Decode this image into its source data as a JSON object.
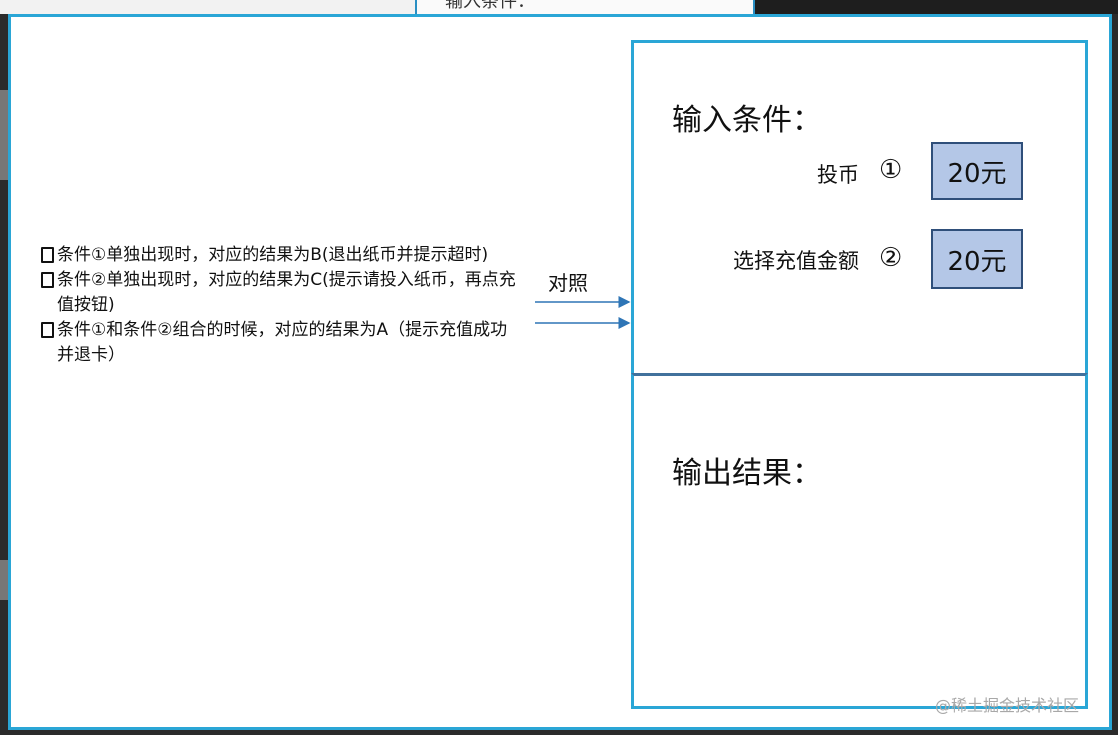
{
  "top_fragment": "输入条件：",
  "conditions": [
    "条件①单独出现时，对应的结果为B(退出纸币并提示超时)",
    "条件②单独出现时，对应的结果为C(提示请投入纸币，再点充值按钮)",
    "条件①和条件②组合的时候，对应的结果为A（提示充值成功并退卡）"
  ],
  "compare_label": "对照",
  "input_box": {
    "heading": "输入条件：",
    "rows": [
      {
        "label": "投币",
        "marker": "①",
        "value": "20元"
      },
      {
        "label": "选择充值金额",
        "marker": "②",
        "value": "20元"
      }
    ]
  },
  "output_box": {
    "heading": "输出结果："
  },
  "watermark": "@稀土掘金技术社区",
  "colors": {
    "frame": "#2aa6d6",
    "divider": "#41719c",
    "value_fill": "#b4c7e7",
    "arrow": "#2e75b6"
  }
}
